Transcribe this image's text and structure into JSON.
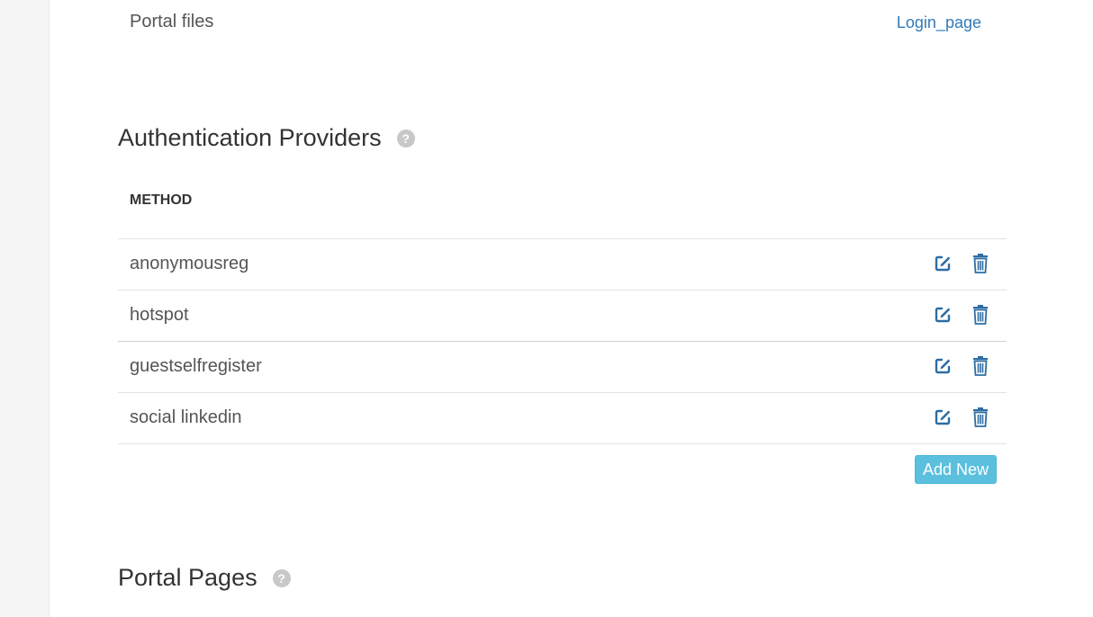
{
  "portal_files": {
    "label": "Portal files",
    "link": "Login_page"
  },
  "auth_providers": {
    "title": "Authentication Providers",
    "help_icon": "question-circle-icon",
    "column_header": "METHOD",
    "rows": [
      {
        "method": "anonymousreg"
      },
      {
        "method": "hotspot"
      },
      {
        "method": "guestselfregister"
      },
      {
        "method": "social linkedin"
      }
    ],
    "edit_icon": "edit-icon",
    "delete_icon": "trash-icon",
    "add_new_label": "Add New"
  },
  "portal_pages": {
    "title": "Portal Pages",
    "help_icon": "question-circle-icon"
  },
  "colors": {
    "link": "#337ab7",
    "action_icon": "#2e6da4",
    "add_button_bg": "#5bc0de",
    "help_icon": "#c8c8c8"
  }
}
